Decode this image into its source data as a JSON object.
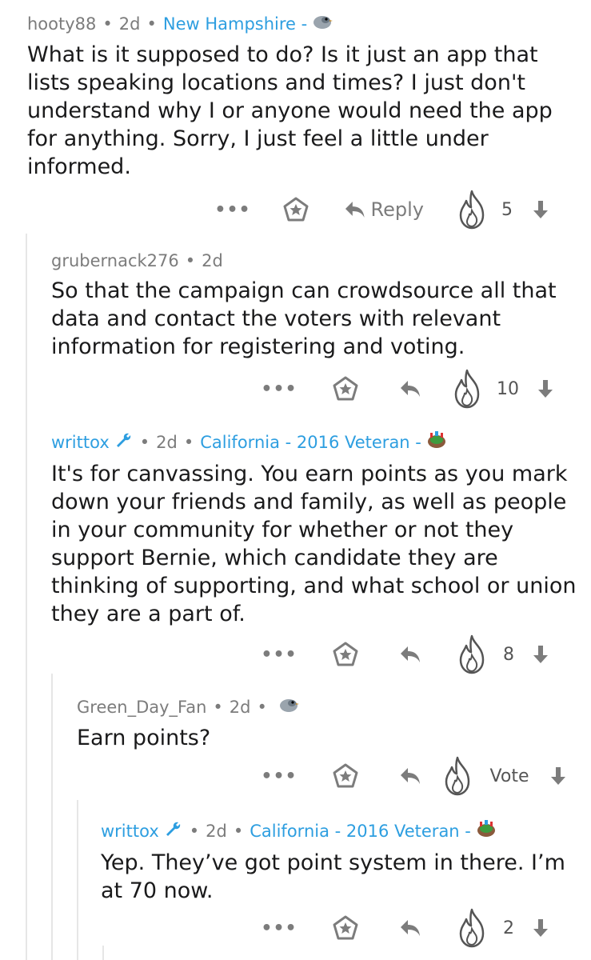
{
  "comments": [
    {
      "user": "hooty88",
      "age": "2d",
      "flair": "New Hampshire -",
      "body": "What is it supposed to do? Is it just an app that lists speaking locations and times? I just don't understand why I or anyone would need the app for anything. Sorry, I just feel a little under informed.",
      "reply_label": "Reply",
      "score": "5"
    },
    {
      "user": "grubernack276",
      "age": "2d",
      "body": "So that the campaign can crowdsource all that data and contact the voters with relevant information for registering and voting.",
      "score": "10"
    },
    {
      "user": "writtox",
      "age": "2d",
      "flair": "California - 2016 Veteran -",
      "body": "It's for canvassing. You earn points as you mark down your friends and family, as well as people in your community for whether or not they support Bernie, which candidate they are thinking of supporting, and what school or union they are a part of.",
      "score": "8"
    },
    {
      "user": "Green_Day_Fan",
      "age": "2d",
      "body": "Earn points?",
      "score": "Vote"
    },
    {
      "user": "writtox",
      "age": "2d",
      "flair": "California - 2016 Veteran -",
      "body": "Yep. They’ve got point system in there. I’m at 70 now.",
      "score": "2"
    }
  ],
  "ui": {
    "dots": "•••",
    "dot_sep": "•"
  },
  "colors": {
    "flair": "#2d9ee0",
    "meta": "#7c7c7c",
    "thread_line": "#e6e6e6"
  }
}
